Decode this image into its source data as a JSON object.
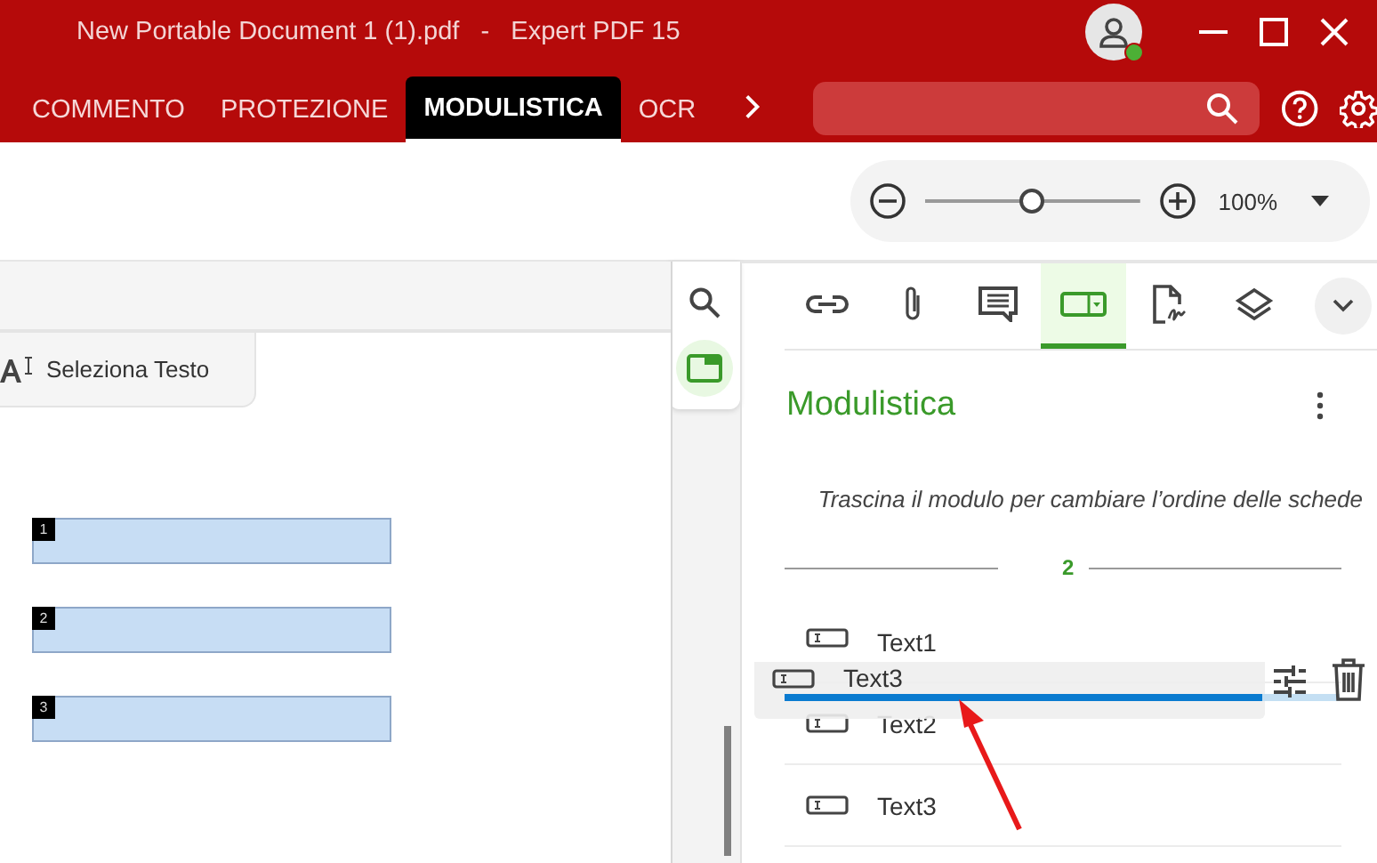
{
  "window": {
    "title": "New Portable Document 1 (1).pdf",
    "separator": "-",
    "app": "Expert PDF 15",
    "user_online": true
  },
  "ribbon_tabs": [
    {
      "label": "COMMENTO",
      "selected": false
    },
    {
      "label": "PROTEZIONE",
      "selected": false
    },
    {
      "label": "MODULISTICA",
      "selected": true
    },
    {
      "label": "OCR",
      "selected": false
    }
  ],
  "zoom": {
    "level": 0.5,
    "reading": "100%"
  },
  "doc_toolbar": {
    "select_text": "Seleziona Testo"
  },
  "form_fields": [
    {
      "number": "1"
    },
    {
      "number": "2"
    },
    {
      "number": "3"
    }
  ],
  "side_rail": [
    {
      "kind": "search",
      "selected": false
    },
    {
      "kind": "form",
      "selected": true
    }
  ],
  "panel_tabs": [
    {
      "kind": "link",
      "selected": false
    },
    {
      "kind": "attachment",
      "selected": false
    },
    {
      "kind": "comment",
      "selected": false
    },
    {
      "kind": "form",
      "selected": true
    },
    {
      "kind": "signature",
      "selected": false
    },
    {
      "kind": "layers",
      "selected": false
    }
  ],
  "panel": {
    "title": "Modulistica",
    "hint": "Trascina il modulo per cambiare l’ordine delle schede",
    "page": "2",
    "fields": [
      {
        "name": "Text1"
      },
      {
        "name": "Text2"
      },
      {
        "name": "Text3"
      }
    ],
    "dragging": {
      "name": "Text3"
    }
  }
}
